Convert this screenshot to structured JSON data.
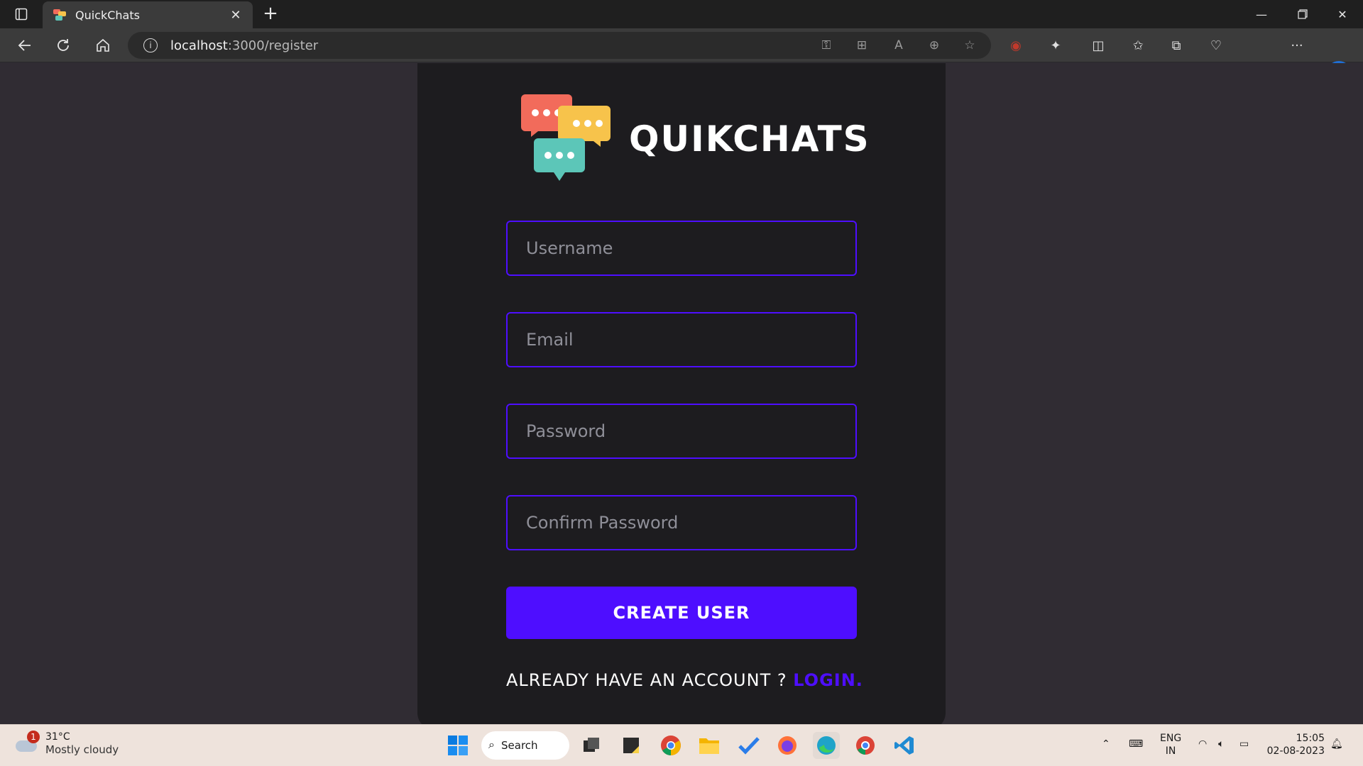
{
  "browser": {
    "tab_title": "QuickChats",
    "url_host": "localhost",
    "url_path": ":3000/register"
  },
  "app": {
    "brand_name": "QUIKCHATS",
    "fields": {
      "username_placeholder": "Username",
      "email_placeholder": "Email",
      "password_placeholder": "Password",
      "confirm_password_placeholder": "Confirm Password"
    },
    "submit_label": "CREATE USER",
    "already_text": "ALREADY HAVE AN ACCOUNT ? ",
    "login_link": "LOGIN.",
    "accent_color": "#4e0eff"
  },
  "taskbar": {
    "weather_badge": "1",
    "weather_temp": "31°C",
    "weather_desc": "Mostly cloudy",
    "search_label": "Search",
    "lang_top": "ENG",
    "lang_bottom": "IN",
    "time": "15:05",
    "date": "02-08-2023"
  }
}
